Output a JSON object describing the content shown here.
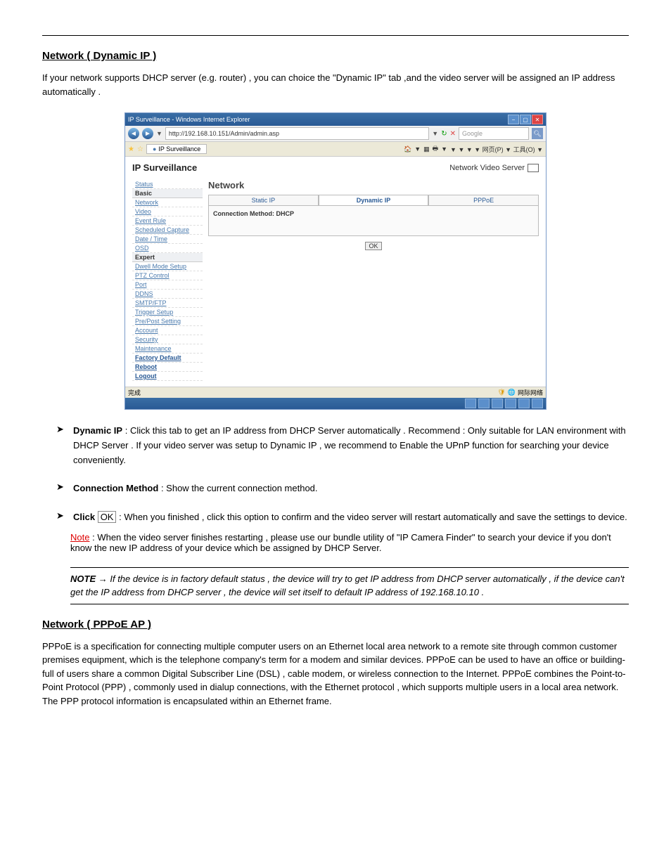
{
  "section1": {
    "header": "Network ( Dynamic IP )",
    "intro": "If your network supports DHCP server (e.g. router) , you can choice the \"Dynamic IP\" tab ,and the video server will be assigned an IP address automatically .",
    "bullets": {
      "ip": {
        "label": "Dynamic IP",
        "text": "Click this tab to get an IP address from DHCP Server automatically . Recommend : Only suitable for LAN environment with DHCP Server . If your video server was setup to Dynamic IP , we recommend to Enable the UPnP function for searching your device conveniently."
      },
      "method": {
        "label": "Connection Method",
        "text": "Show the current connection method."
      },
      "ok": {
        "label": "Click OK",
        "text": "When you finished , click this option to confirm and the video server will restart automatically and save the settings to device."
      }
    },
    "note_prefix": "Note",
    "note_text": ": When the video server finishes restarting , please use our bundle utility of \"IP Camera Finder\" to search your device if you don't know the new IP address of your device which be assigned by DHCP Server.",
    "boxed_note_prefix": "NOTE",
    "boxed_note": "→ If the device is in factory default status , the device will try to get IP address from DHCP server automatically , if the device can't get the IP address from DHCP server , the device will set itself to default IP address of 192.168.10.10 ."
  },
  "section2": {
    "header": "Network ( PPPoE AP )",
    "intro": "PPPoE is a specification for connecting multiple computer users on an Ethernet local area network to a remote site through common customer premises equipment, which is the telephone company's term for a modem and similar devices. PPPoE can be used to have an office or building-full of users share a common Digital Subscriber Line (DSL) , cable modem, or wireless connection to the Internet. PPPoE combines the Point-to-Point Protocol (PPP) , commonly used in dialup connections, with the Ethernet protocol , which supports multiple users in a local area network. The PPP protocol information is encapsulated within an Ethernet frame."
  },
  "browser": {
    "title": "IP Surveillance - Windows Internet Explorer",
    "url": "http://192.168.10.151/Admin/admin.asp",
    "search_placeholder": "Google",
    "tab": "IP Surveillance",
    "toolbar": "▼  ▼  ▼  ▼  网页(P) ▼  工具(O) ▼",
    "page_title": "IP Surveillance",
    "page_subtitle": "Network Video Server",
    "sidebar": {
      "status": "Status",
      "basic": "Basic",
      "network": "Network",
      "video": "Video",
      "event_rule": "Event Rule",
      "scheduled_capture": "Scheduled Capture",
      "date_time": "Date / Time",
      "osd": "OSD",
      "expert": "Expert",
      "dwell_mode": "Dwell Mode Setup",
      "ptz_control": "PTZ Control",
      "port": "Port",
      "ddns": "DDNS",
      "smtp_ftp": "SMTP/FTP",
      "trigger_setup": "Trigger Setup",
      "pre_post": "Pre/Post Setting",
      "account": "Account",
      "security": "Security",
      "maintenance": "Maintenance",
      "factory_default": "Factory Default",
      "reboot": "Reboot",
      "logout": "Logout"
    },
    "main": {
      "title": "Network",
      "tab_static": "Static IP",
      "tab_dynamic": "Dynamic IP",
      "tab_pppoe": "PPPoE",
      "panel_text": "Connection Method: DHCP",
      "ok": "OK"
    },
    "status_left": "完成",
    "status_right": "网际网络"
  }
}
